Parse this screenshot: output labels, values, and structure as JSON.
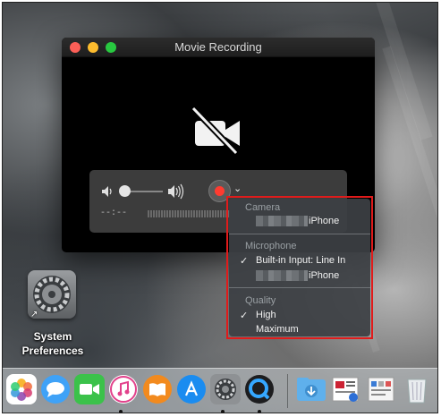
{
  "window": {
    "title": "Movie Recording"
  },
  "controls": {
    "timecode": "--:--"
  },
  "menu": {
    "camera_header": "Camera",
    "camera_item": "iPhone",
    "microphone_header": "Microphone",
    "mic_item_selected": "Built-in Input: Line In",
    "mic_item_2": "iPhone",
    "quality_header": "Quality",
    "quality_selected": "High",
    "quality_item_2": "Maximum",
    "check_glyph": "✓"
  },
  "desktop": {
    "icon_label_line1": "System",
    "icon_label_line2": "Preferences"
  },
  "dock": {
    "apps": [
      "photos-icon",
      "messages-icon",
      "facetime-icon",
      "itunes-icon",
      "ibooks-icon",
      "app-store-icon",
      "system-preferences-icon",
      "quicktime-icon",
      "downloads-folder-icon",
      "document-stack-icon",
      "document-stack-icon-2",
      "trash-icon"
    ]
  },
  "colors": {
    "highlight_border": "#e01b1b",
    "record_red": "#ff3b30"
  }
}
